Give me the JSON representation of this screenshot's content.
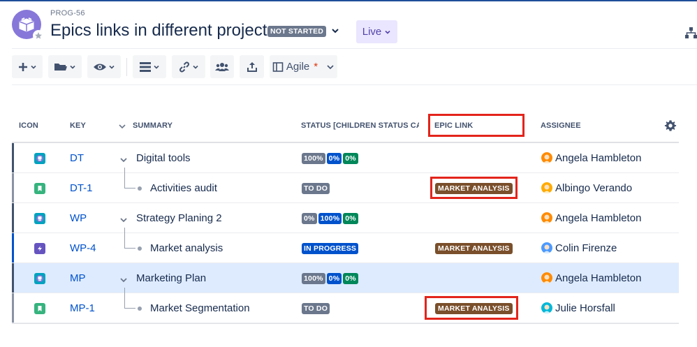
{
  "header": {
    "project_key": "PROG-56",
    "title": "Epics links in different project",
    "status": "NOT STARTED",
    "live_label": "Live"
  },
  "toolbar": {
    "items": [
      "add-icon",
      "folder-icon",
      "eye-icon",
      "fields-icon",
      "link-icon",
      "team-icon",
      "export-icon"
    ],
    "view_label": "Agile",
    "view_modified_marker": "*"
  },
  "table": {
    "columns": {
      "icon": "ICON",
      "key": "KEY",
      "summary": "SUMMARY",
      "status": "STATUS [CHILDREN STATUS CA",
      "epic_link": "EPIC LINK",
      "assignee": "ASSIGNEE"
    },
    "rows": [
      {
        "key": "DT",
        "summary": "Digital tools",
        "type": "epic",
        "statuses": [
          "100%",
          "0%",
          "0%"
        ],
        "epic_link": "",
        "assignee": "Angela Hambleton"
      },
      {
        "key": "DT-1",
        "summary": "Activities audit",
        "type": "story",
        "statuses": [
          "TO DO"
        ],
        "epic_link": "MARKET ANALYSIS",
        "assignee": "Albingo Verando"
      },
      {
        "key": "WP",
        "summary": "Strategy Planing 2",
        "type": "epic",
        "statuses": [
          "0%",
          "100%",
          "0%"
        ],
        "epic_link": "",
        "assignee": "Angela Hambleton"
      },
      {
        "key": "WP-4",
        "summary": "Market analysis",
        "type": "epic-purple",
        "statuses": [
          "IN PROGRESS"
        ],
        "epic_link": "MARKET ANALYSIS",
        "assignee": "Colin Firenze"
      },
      {
        "key": "MP",
        "summary": "Marketing Plan",
        "type": "epic",
        "statuses": [
          "100%",
          "0%",
          "0%"
        ],
        "epic_link": "",
        "assignee": "Angela Hambleton"
      },
      {
        "key": "MP-1",
        "summary": "Market Segmentation",
        "type": "story",
        "statuses": [
          "TO DO"
        ],
        "epic_link": "MARKET ANALYSIS",
        "assignee": "Julie Horsfall"
      }
    ]
  },
  "colors": {
    "accent": "#0052cc",
    "status_gray": "#6b778c",
    "status_blue": "#0052cc",
    "status_green": "#00875a",
    "epic_brown": "#7a4f2b",
    "highlight_row": "#deebff",
    "annotation_red": "#e3241b"
  }
}
